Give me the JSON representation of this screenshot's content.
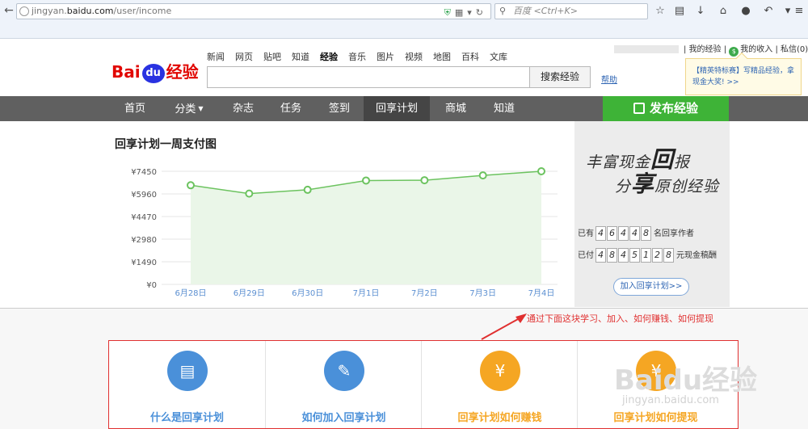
{
  "browser": {
    "url_prefix": "jingyan.",
    "url_domain": "baidu.com",
    "url_path": "/user/income",
    "search_placeholder": "百度 <Ctrl+K>"
  },
  "header": {
    "logo_bai": "Bai",
    "logo_du": "du",
    "logo_jy": "经验",
    "topnav": [
      "新闻",
      "网页",
      "贴吧",
      "知道",
      "经验",
      "音乐",
      "图片",
      "视频",
      "地图",
      "百科",
      "文库"
    ],
    "topnav_active": "经验",
    "search_button": "搜索经验",
    "help": "帮助",
    "user_links": {
      "my_exp": "我的经验",
      "my_income": "我的收入",
      "messages": "私信(0)"
    },
    "tip": "【精英特标赛】写精品经验，拿现金大奖! >>"
  },
  "mainnav": {
    "tabs": [
      "首页",
      "分类",
      "杂志",
      "任务",
      "签到",
      "回享计划",
      "商城",
      "知道"
    ],
    "active": "回享计划",
    "publish": "发布经验"
  },
  "chart": {
    "title": "回享计划一周支付图"
  },
  "chart_data": {
    "type": "area",
    "title": "回享计划一周支付图",
    "categories": [
      "6月28日",
      "6月29日",
      "6月30日",
      "7月1日",
      "7月2日",
      "7月3日",
      "7月4日"
    ],
    "values": [
      6530,
      5980,
      6230,
      6840,
      6860,
      7180,
      7450
    ],
    "y_ticks": [
      "¥0",
      "¥1490",
      "¥2980",
      "¥4470",
      "¥5960",
      "¥7450"
    ],
    "ylim": [
      0,
      7450
    ],
    "grid": true,
    "colors": {
      "line": "#6cc35f",
      "fill": "#eaf6e8",
      "marker": "#6cc35f"
    }
  },
  "banner": {
    "slogan1_pre": "丰富现金",
    "slogan1_big": "回",
    "slogan1_post": "报",
    "slogan2_pre": "分",
    "slogan2_big": "享",
    "slogan2_post": "原创经验",
    "authors_prefix": "已有",
    "authors_digits": [
      "4",
      "6",
      "4",
      "4",
      "8"
    ],
    "authors_suffix": "名回享作者",
    "paid_prefix": "已付",
    "paid_digits": [
      "4",
      "8",
      "4",
      "5",
      "1",
      "2",
      "8"
    ],
    "paid_suffix": "元现金稿酬",
    "join": "加入回享计划>>"
  },
  "annotation": "通过下面这块学习、加入、如何赚钱、如何提现",
  "steps": [
    {
      "label": "什么是回享计划",
      "icon": "book-icon",
      "color": "#4a90d9",
      "glyph": "▤"
    },
    {
      "label": "如何加入回享计划",
      "icon": "edit-icon",
      "color": "#4a90d9",
      "glyph": "✎"
    },
    {
      "label": "回享计划如何赚钱",
      "icon": "money-bag-icon",
      "color": "#f5a623",
      "glyph": "¥"
    },
    {
      "label": "回享计划如何提现",
      "icon": "withdraw-icon",
      "color": "#f5a623",
      "glyph": "¥"
    }
  ],
  "watermark": {
    "text": "Baidu经验",
    "url": "jingyan.baidu.com"
  }
}
